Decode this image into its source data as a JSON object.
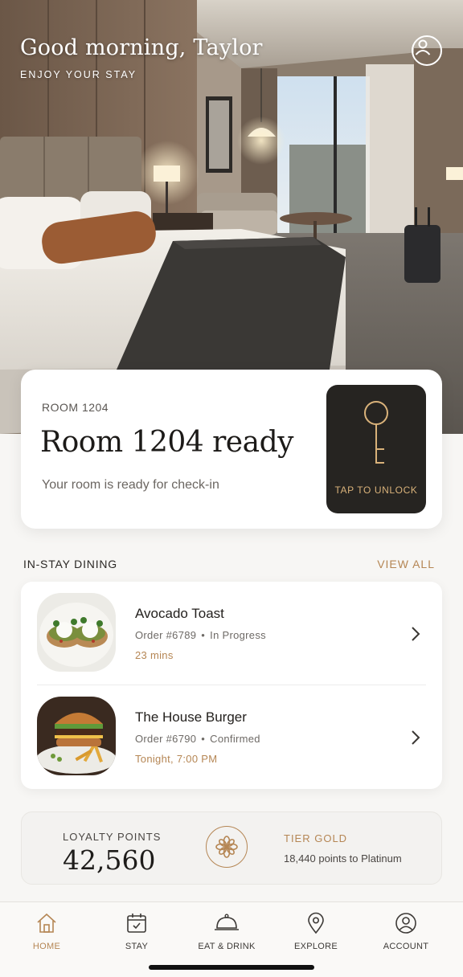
{
  "header": {
    "greeting": "Good morning, Taylor",
    "subtitle": "ENJOY YOUR STAY",
    "profile_icon": "user-circle-icon"
  },
  "room": {
    "eyebrow": "ROOM 1204",
    "title": "Room 1204 ready",
    "status": "Your room is ready for check-in",
    "unlock_label": "TAP TO UNLOCK",
    "unlock_icon": "key-icon"
  },
  "dining": {
    "section_title": "IN-STAY DINING",
    "view_all": "VIEW ALL",
    "orders": [
      {
        "name": "Avocado Toast",
        "order_number": "Order #6789",
        "status": "In Progress",
        "time": "23 mins"
      },
      {
        "name": "The House Burger",
        "order_number": "Order #6790",
        "status": "Confirmed",
        "time": "Tonight, 7:00 PM"
      }
    ]
  },
  "loyalty": {
    "label": "LOYALTY POINTS",
    "points": "42,560",
    "tier": "TIER GOLD",
    "progress": "18,440 points to Platinum"
  },
  "tabs": [
    {
      "label": "HOME",
      "icon": "home-icon",
      "active": true
    },
    {
      "label": "STAY",
      "icon": "calendar-icon",
      "active": false
    },
    {
      "label": "EAT & DRINK",
      "icon": "cloche-icon",
      "active": false
    },
    {
      "label": "EXPLORE",
      "icon": "map-pin-icon",
      "active": false
    },
    {
      "label": "ACCOUNT",
      "icon": "user-circle-icon",
      "active": false
    }
  ],
  "colors": {
    "accent": "#b58654",
    "dark": "#262421",
    "background": "#f7f6f4"
  }
}
